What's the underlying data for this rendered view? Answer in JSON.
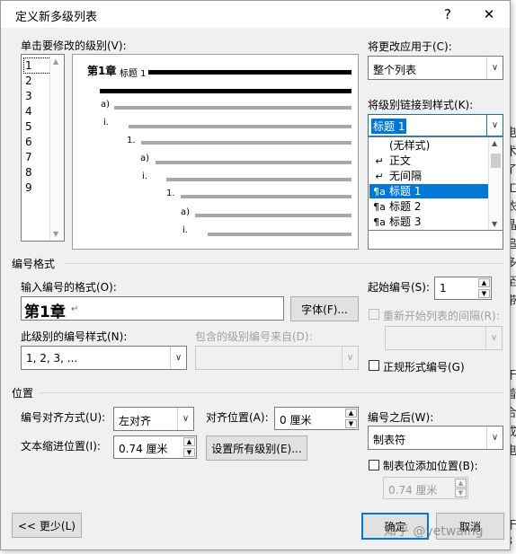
{
  "background_text": [
    "电",
    "术",
    "了",
    "工",
    "依",
    "晶",
    "追",
    "多",
    "至",
    "带",
    "，",
    "于",
    "着",
    "合",
    "成",
    "电",
    "，",
    "于",
    "3"
  ],
  "dialog": {
    "title": "定义新多级列表",
    "help_label": "?",
    "close_label": "✕"
  },
  "level_select": {
    "label": "单击要修改的级别(V):",
    "levels": [
      "1",
      "2",
      "3",
      "4",
      "5",
      "6",
      "7",
      "8",
      "9"
    ],
    "selected": "1"
  },
  "preview": {
    "heading_text": "第1章",
    "heading_style": "标题 1",
    "lines": [
      {
        "label": "a)"
      },
      {
        "label": "i."
      },
      {
        "label": "1."
      },
      {
        "label": "a)"
      },
      {
        "label": "i."
      },
      {
        "label": "1."
      },
      {
        "label": "a)"
      },
      {
        "label": "i."
      }
    ]
  },
  "apply_to": {
    "label": "将更改应用于(C):",
    "value": "整个列表"
  },
  "link_style": {
    "label": "将级别链接到样式(K):",
    "value": "标题 1",
    "options": [
      {
        "icon": "",
        "label": "(无样式)"
      },
      {
        "icon": "↵",
        "label": "正文"
      },
      {
        "icon": "↵",
        "label": "无间隔"
      },
      {
        "icon": "¶a",
        "label": "标题 1"
      },
      {
        "icon": "¶a",
        "label": "标题 2"
      },
      {
        "icon": "¶a",
        "label": "标题 3"
      }
    ],
    "selected_index": 3
  },
  "number_format": {
    "section": "编号格式",
    "format_label": "输入编号的格式(O):",
    "format_value": "第1章",
    "font_button": "字体(F)...",
    "style_label": "此级别的编号样式(N):",
    "style_value": "1, 2, 3, ...",
    "include_label": "包含的级别编号来自(D):",
    "include_value": ""
  },
  "start": {
    "label": "起始编号(S):",
    "value": "1",
    "restart_label": "重新开始列表的间隔(R):",
    "restart_value": "",
    "legal_label": "正规形式编号(G)"
  },
  "position": {
    "section": "位置",
    "align_label": "编号对齐方式(U):",
    "align_value": "左对齐",
    "align_at_label": "对齐位置(A):",
    "align_at_value": "0 厘米",
    "indent_label": "文本缩进位置(I):",
    "indent_value": "0.74 厘米",
    "set_all_button": "设置所有级别(E)...",
    "follow_label": "编号之后(W):",
    "follow_value": "制表符",
    "tab_stop_label": "制表位添加位置(B):",
    "tab_stop_value": "0.74 厘米"
  },
  "buttons": {
    "less": "<< 更少(L)",
    "ok": "确定",
    "cancel": "取消"
  },
  "watermark": "知乎 @yetwaing",
  "colors": {
    "selection": "#0078d7",
    "dialog_bg": "#f0f0f0",
    "default_button_border": "#0078d7"
  }
}
